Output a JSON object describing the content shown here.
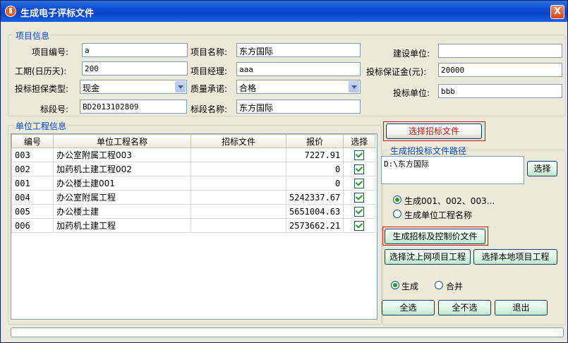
{
  "window": {
    "title": "生成电子评标文件",
    "close": "X"
  },
  "project_info": {
    "group_title": "项目信息",
    "project_no_label": "项目编号:",
    "project_no": "a",
    "project_name_label": "项目名称:",
    "project_name": "东方国际",
    "builder_label": "建设单位:",
    "builder": "",
    "duration_label": "工期(日历天):",
    "duration": "200",
    "manager_label": "项目经理:",
    "manager": "aaa",
    "deposit_label": "投标保证金(元):",
    "deposit": "20000",
    "guarantee_label": "投标担保类型:",
    "guarantee": "现金",
    "quality_label": "质量承诺:",
    "quality": "合格",
    "bidder_label": "投标单位:",
    "bidder": "bbb",
    "section_no_label": "标段号:",
    "section_no": "BD2013102809",
    "section_name_label": "标段名称:",
    "section_name": "东方国际"
  },
  "unit_info": {
    "group_title": "单位工程信息",
    "columns": [
      "编号",
      "单位工程名称",
      "招标文件",
      "报价",
      "选择"
    ],
    "rows": [
      {
        "code": "003",
        "name": "办公室附属工程003",
        "file": "",
        "price": "7227.91"
      },
      {
        "code": "002",
        "name": "加药机土建工程002",
        "file": "",
        "price": "0"
      },
      {
        "code": "001",
        "name": "办公楼土建001",
        "file": "",
        "price": "0"
      },
      {
        "code": "004",
        "name": "办公室附属工程",
        "file": "",
        "price": "5242337.67"
      },
      {
        "code": "005",
        "name": "办公楼土建",
        "file": "",
        "price": "5651004.63"
      },
      {
        "code": "006",
        "name": "加药机土建工程",
        "file": "",
        "price": "2573662.21"
      }
    ]
  },
  "right_panel": {
    "select_bid_file": "选择招标文件",
    "path_group_title": "生成招投标文件路径",
    "path_value": "D:\\东方国际",
    "select_button": "选择",
    "radio_gen_codes": "生成001、002、003...",
    "radio_gen_names": "生成单位工程名称",
    "gen_control_file": "生成招标及控制价文件",
    "select_online_project": "选择沈上网项目工程",
    "select_local_project": "选择本地项目工程",
    "radio_generate": "生成",
    "radio_merge": "合并",
    "select_all": "全选",
    "select_none": "全不选",
    "exit": "退出"
  },
  "colors": {
    "title_bar": "#0b4cd6",
    "accent_red": "#d01010",
    "group_title": "#0046d5"
  }
}
